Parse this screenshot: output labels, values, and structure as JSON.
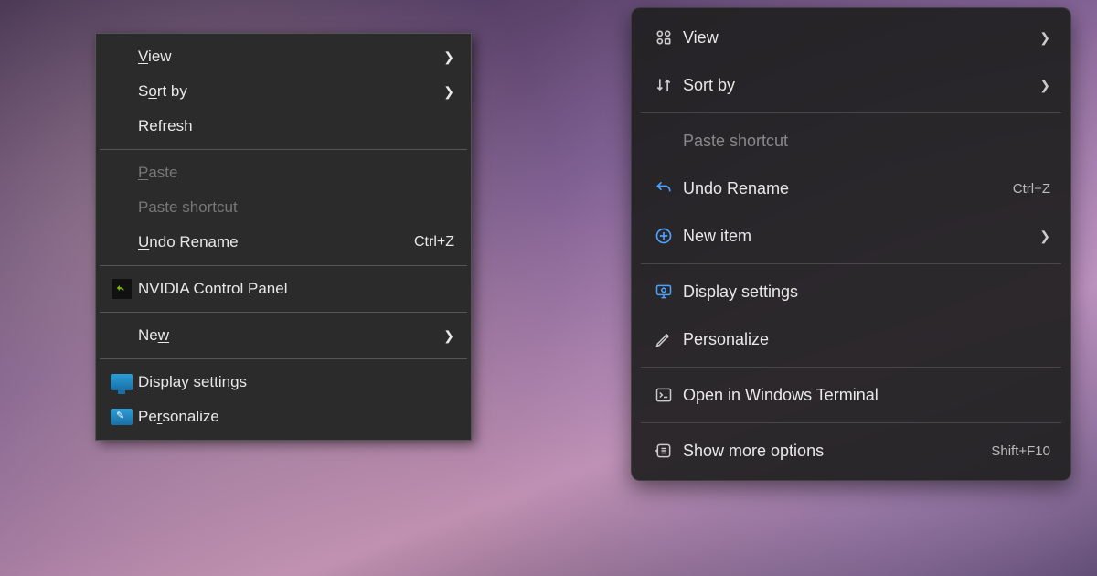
{
  "win10_menu": {
    "items": [
      {
        "label_pre": "",
        "mnemonic": "V",
        "label_post": "iew",
        "chevron": true
      },
      {
        "label_pre": "S",
        "mnemonic": "o",
        "label_post": "rt by",
        "chevron": true
      },
      {
        "label_pre": "R",
        "mnemonic": "e",
        "label_post": "fresh"
      }
    ],
    "paste": {
      "mnemonic": "P",
      "label_post": "aste"
    },
    "paste_shortcut": {
      "label": "Paste shortcut"
    },
    "undo": {
      "mnemonic": "U",
      "label_post": "ndo Rename",
      "accel": "Ctrl+Z"
    },
    "nvidia": {
      "label": "NVIDIA Control Panel"
    },
    "new": {
      "label_pre": "Ne",
      "mnemonic": "w",
      "chevron": true
    },
    "display": {
      "mnemonic": "D",
      "label_post": "isplay settings"
    },
    "personalize": {
      "label_pre": "Pe",
      "mnemonic": "r",
      "label_post": "sonalize"
    }
  },
  "win11_menu": {
    "view": {
      "label": "View",
      "chevron": true
    },
    "sort": {
      "label": "Sort by",
      "chevron": true
    },
    "paste_shortcut": {
      "label": "Paste shortcut"
    },
    "undo": {
      "label": "Undo Rename",
      "accel": "Ctrl+Z"
    },
    "new_item": {
      "label": "New item",
      "chevron": true
    },
    "display": {
      "label": "Display settings"
    },
    "personalize": {
      "label": "Personalize"
    },
    "terminal": {
      "label": "Open in Windows Terminal"
    },
    "more": {
      "label": "Show more options",
      "accel": "Shift+F10"
    }
  }
}
